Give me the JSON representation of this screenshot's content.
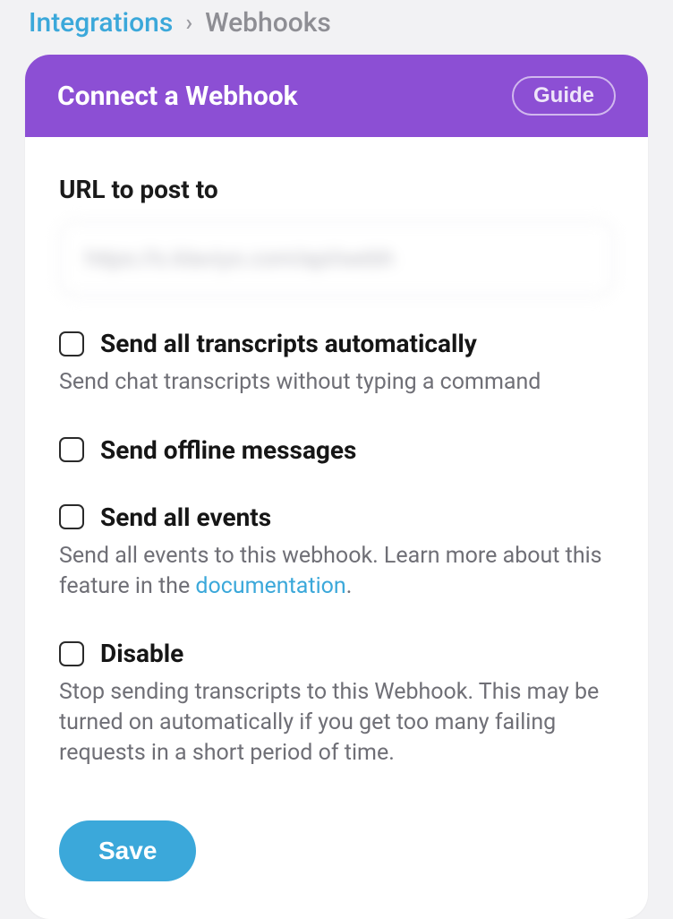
{
  "breadcrumb": {
    "link": "Integrations",
    "separator": "›",
    "current": "Webhooks"
  },
  "header": {
    "title": "Connect a Webhook",
    "guide_label": "Guide"
  },
  "form": {
    "url_label": "URL to post to",
    "url_value": "https://s.klaviyo.com/api/webh",
    "options": [
      {
        "title": "Send all transcripts automatically",
        "desc": "Send chat transcripts without typing a command"
      },
      {
        "title": "Send offline messages",
        "desc": ""
      },
      {
        "title": "Send all events",
        "desc_pre": "Send all events to this webhook. Learn more about this feature in the ",
        "desc_link": "documentation",
        "desc_post": "."
      },
      {
        "title": "Disable",
        "desc": "Stop sending transcripts to this Webhook. This may be turned on automatically if you get too many failing requests in a short period of time."
      }
    ],
    "save_label": "Save"
  }
}
